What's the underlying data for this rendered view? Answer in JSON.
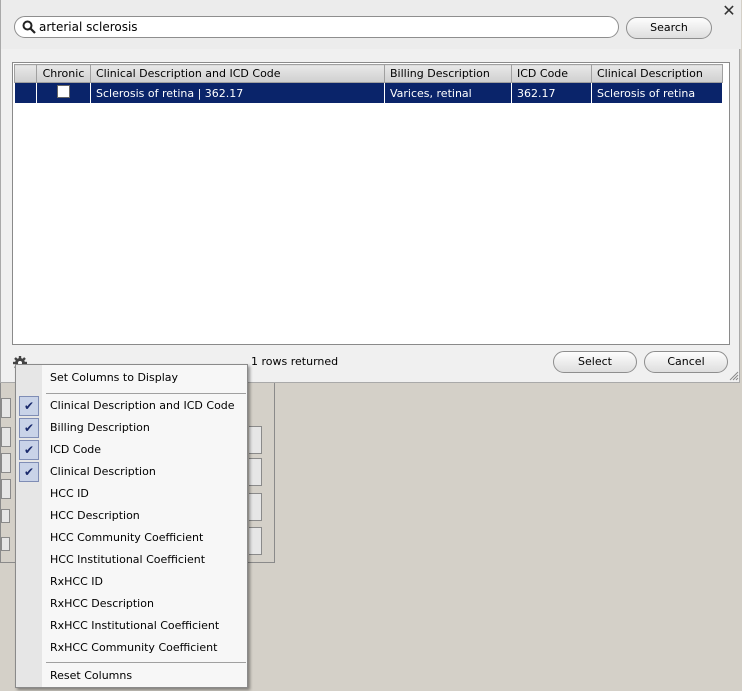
{
  "search": {
    "value": "arterial sclerosis",
    "button_label": "Search"
  },
  "grid": {
    "columns": [
      "",
      "Chronic",
      "Clinical Description and ICD Code",
      "Billing Description",
      "ICD Code",
      "Clinical Description"
    ],
    "rows": [
      {
        "chronic": false,
        "clinical_icd": "Sclerosis of retina  |  362.17",
        "billing": "Varices, retinal",
        "icd": "362.17",
        "clinical": "Sclerosis of retina"
      }
    ]
  },
  "footer": {
    "rows_returned": "1 rows returned",
    "select_label": "Select",
    "cancel_label": "Cancel"
  },
  "menu": {
    "title": "Set Columns to Display",
    "items": [
      {
        "label": "Clinical Description and ICD Code",
        "checked": true
      },
      {
        "label": "Billing Description",
        "checked": true
      },
      {
        "label": "ICD Code",
        "checked": true
      },
      {
        "label": "Clinical Description",
        "checked": true
      },
      {
        "label": "HCC ID",
        "checked": false
      },
      {
        "label": "HCC Description",
        "checked": false
      },
      {
        "label": "HCC Community Coefficient",
        "checked": false
      },
      {
        "label": "HCC Institutional Coefficient",
        "checked": false
      },
      {
        "label": "RxHCC ID",
        "checked": false
      },
      {
        "label": "RxHCC Description",
        "checked": false
      },
      {
        "label": "RxHCC Institutional Coefficient",
        "checked": false
      },
      {
        "label": "RxHCC Community Coefficient",
        "checked": false
      }
    ],
    "reset_label": "Reset Columns"
  },
  "colors": {
    "selected_row": "#0a246a",
    "check_bg": "#c9d3e8"
  }
}
